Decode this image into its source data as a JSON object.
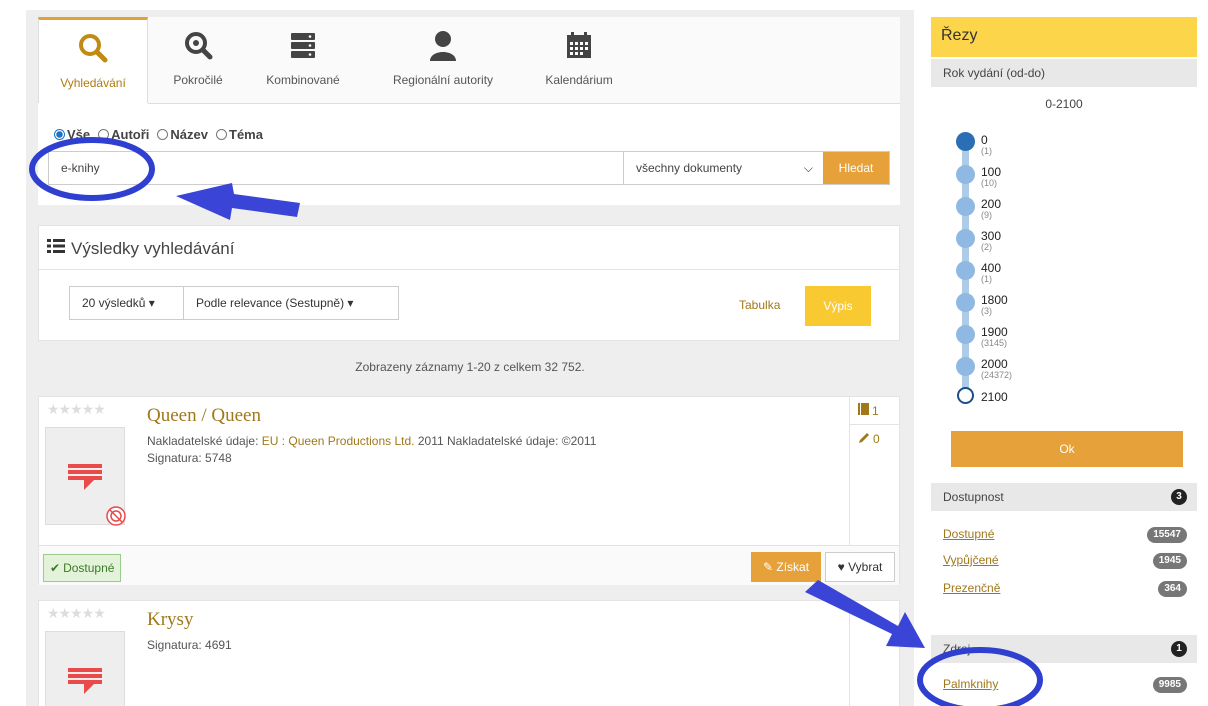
{
  "tabs": [
    {
      "label": "Vyhledávání",
      "icon": "search-icon",
      "active": true
    },
    {
      "label": "Pokročilé",
      "icon": "zoom-icon"
    },
    {
      "label": "Kombinované",
      "icon": "server-stack-icon"
    },
    {
      "label": "Regionální autority",
      "icon": "user-icon"
    },
    {
      "label": "Kalendárium",
      "icon": "calendar-icon"
    }
  ],
  "radios": [
    {
      "label": "Vše",
      "selected": true
    },
    {
      "label": "Autoři"
    },
    {
      "label": "Název"
    },
    {
      "label": "Téma"
    }
  ],
  "search": {
    "value": "e-knihy",
    "doc_type": "všechny dokumenty",
    "button": "Hledat"
  },
  "results": {
    "title": "Výsledky vyhledávání",
    "per_page": "20 výsledků",
    "sort": "Podle relevance (Sestupně)",
    "view_table": "Tabulka",
    "view_list": "Výpis",
    "summary": "Zobrazeny záznamy 1-20 z celkem 32 752."
  },
  "records": [
    {
      "stars": "★★★★★",
      "title": "Queen / Queen",
      "publisher_label": "Nakladatelské údaje:",
      "publisher_link": "EU : Queen Productions Ltd.",
      "publisher_rest": "2011 Nakladatelské údaje: ©2011",
      "signature": "Signatura: 5748",
      "copies": "1",
      "reviews": "0",
      "availability": "Dostupné",
      "get": "Získat",
      "choose": "Vybrat"
    },
    {
      "stars": "★★★★★",
      "title": "Krysy",
      "signature": "Signatura: 4691"
    }
  ],
  "sidebar": {
    "title": "Řezy",
    "year_section": "Rok vydání (od-do)",
    "range": "0-2100",
    "ticks": [
      {
        "label": "0",
        "count": "(1)"
      },
      {
        "label": "100",
        "count": "(10)"
      },
      {
        "label": "200",
        "count": "(9)"
      },
      {
        "label": "300",
        "count": "(2)"
      },
      {
        "label": "400",
        "count": "(1)"
      },
      {
        "label": "1800",
        "count": "(3)"
      },
      {
        "label": "1900",
        "count": "(3145)"
      },
      {
        "label": "2000",
        "count": "(24372)"
      },
      {
        "label": "2100",
        "count": ""
      }
    ],
    "ok": "Ok",
    "availability_section": "Dostupnost",
    "availability_count": "3",
    "availability": [
      {
        "label": "Dostupné",
        "count": "15547"
      },
      {
        "label": "Vypůjčené",
        "count": "1945"
      },
      {
        "label": "Prezenčně",
        "count": "364"
      }
    ],
    "source_section": "Zdroj",
    "source_count": "1",
    "source": [
      {
        "label": "Palmknihy",
        "count": "9985"
      }
    ]
  },
  "colors": {
    "accent": "#e6a13a",
    "brand_link": "#a0781a",
    "header_yellow": "#fcd54a",
    "annotation_blue": "#2f3fd0"
  }
}
